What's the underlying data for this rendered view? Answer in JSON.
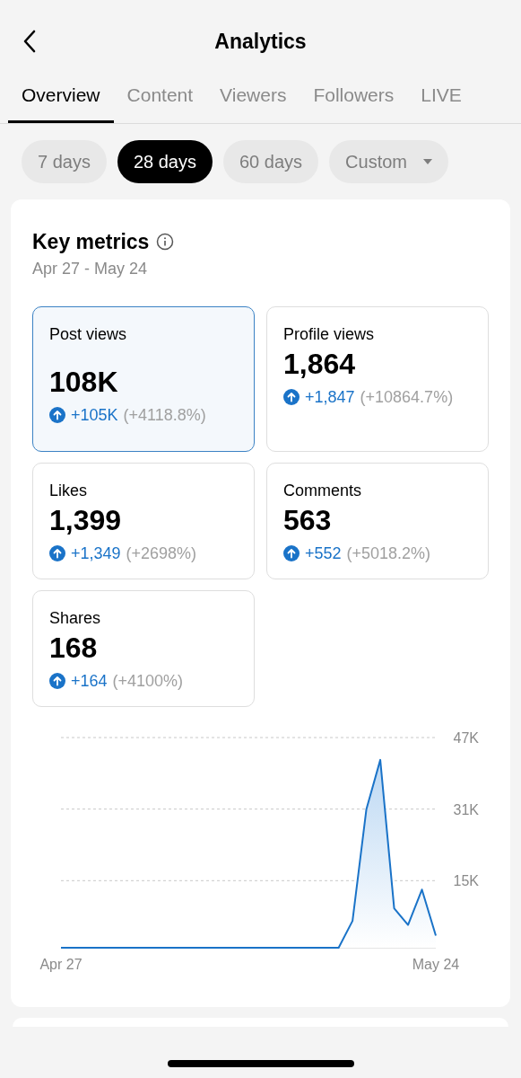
{
  "header": {
    "title": "Analytics"
  },
  "tabs": [
    {
      "label": "Overview",
      "selected": true
    },
    {
      "label": "Content",
      "selected": false
    },
    {
      "label": "Viewers",
      "selected": false
    },
    {
      "label": "Followers",
      "selected": false
    },
    {
      "label": "LIVE",
      "selected": false
    }
  ],
  "ranges": [
    {
      "label": "7 days",
      "selected": false,
      "kind": "pill"
    },
    {
      "label": "28 days",
      "selected": true,
      "kind": "pill"
    },
    {
      "label": "60 days",
      "selected": false,
      "kind": "pill"
    },
    {
      "label": "Custom",
      "selected": false,
      "kind": "dropdown"
    }
  ],
  "key_metrics": {
    "title": "Key metrics",
    "date_range": "Apr 27 - May 24",
    "metrics": [
      {
        "label": "Post views",
        "value": "108K",
        "change": "+105K",
        "percent": "(+4118.8%)",
        "selected": true
      },
      {
        "label": "Profile views",
        "value": "1,864",
        "change": "+1,847",
        "percent": "(+10864.7%)",
        "selected": false
      },
      {
        "label": "Likes",
        "value": "1,399",
        "change": "+1,349",
        "percent": "(+2698%)",
        "selected": false
      },
      {
        "label": "Comments",
        "value": "563",
        "change": "+552",
        "percent": "(+5018.2%)",
        "selected": false
      },
      {
        "label": "Shares",
        "value": "168",
        "change": "+164",
        "percent": "(+4100%)",
        "selected": false
      }
    ],
    "chart_data": {
      "type": "area",
      "categories": [
        "Apr 27",
        null,
        null,
        null,
        null,
        null,
        null,
        null,
        null,
        null,
        null,
        null,
        null,
        null,
        null,
        null,
        null,
        null,
        null,
        null,
        null,
        null,
        null,
        null,
        null,
        null,
        null,
        "May 24"
      ],
      "series": [
        {
          "color": "#1a73c8",
          "values": [
            0,
            0,
            0,
            0,
            0,
            0,
            0,
            0,
            0,
            0,
            0,
            0,
            0,
            0,
            0,
            0,
            0,
            0,
            0,
            0,
            0,
            6000,
            31000,
            42000,
            8800,
            5100,
            13000,
            2700
          ]
        }
      ],
      "ylim": [
        0,
        47000
      ],
      "yticks": [
        {
          "value": 15000,
          "label": "15K"
        },
        {
          "value": 31000,
          "label": "31K"
        },
        {
          "value": 47000,
          "label": "47K"
        }
      ]
    }
  }
}
